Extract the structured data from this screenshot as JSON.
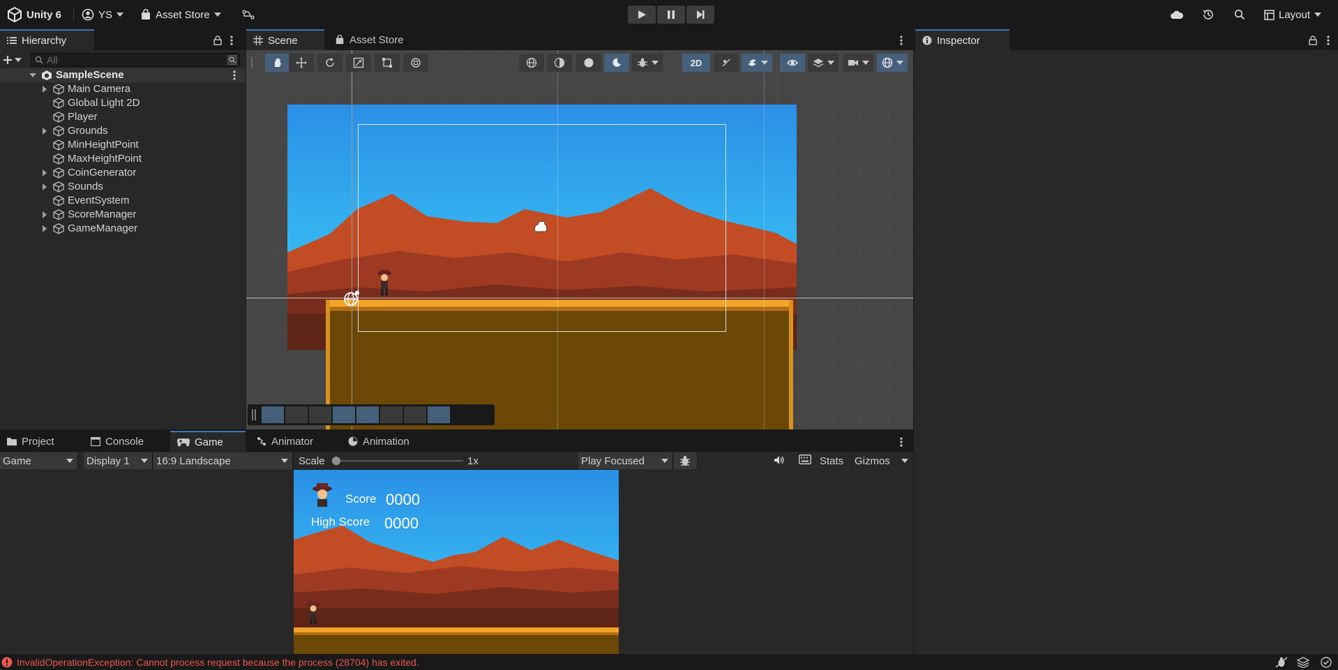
{
  "topbar": {
    "app_name": "Unity 6",
    "account": "YS",
    "asset_store_menu": "Asset Store",
    "layout_label": "Layout"
  },
  "hierarchy": {
    "tab_label": "Hierarchy",
    "search_placeholder": "All",
    "scene_name": "SampleScene",
    "items": [
      {
        "label": "Main Camera",
        "expandable": true
      },
      {
        "label": "Global Light 2D",
        "expandable": false
      },
      {
        "label": "Player",
        "expandable": false
      },
      {
        "label": "Grounds",
        "expandable": true
      },
      {
        "label": "MinHeightPoint",
        "expandable": false
      },
      {
        "label": "MaxHeightPoint",
        "expandable": false
      },
      {
        "label": "CoinGenerator",
        "expandable": true
      },
      {
        "label": "Sounds",
        "expandable": true
      },
      {
        "label": "EventSystem",
        "expandable": false
      },
      {
        "label": "ScoreManager",
        "expandable": true
      },
      {
        "label": "GameManager",
        "expandable": true
      }
    ]
  },
  "scene_tabs": {
    "scene": "Scene",
    "asset_store": "Asset Store"
  },
  "scene_toolbar": {
    "mode_2d": "2D"
  },
  "inspector": {
    "tab_label": "Inspector"
  },
  "bottom_tabs": {
    "project": "Project",
    "console": "Console",
    "game": "Game",
    "animator": "Animator",
    "animation": "Animation"
  },
  "game_view": {
    "view_mode": "Game",
    "display": "Display 1",
    "aspect": "16:9 Landscape",
    "scale_label": "Scale",
    "scale_value": "1x",
    "play_mode": "Play Focused",
    "stats": "Stats",
    "gizmos": "Gizmos"
  },
  "game_hud": {
    "score_label": "Score",
    "score_value": "0000",
    "high_score_label": "High Score",
    "high_score_value": "0000"
  },
  "status": {
    "error_message": "InvalidOperationException: Cannot process request because the process (28704) has exited."
  },
  "colors": {
    "accent": "#3a79bb",
    "error": "#e8584d",
    "sky_top": "#2e9ae8",
    "sky_bottom": "#39c9f5",
    "ground": "#6b4806",
    "ground_top": "#f0a52a"
  }
}
